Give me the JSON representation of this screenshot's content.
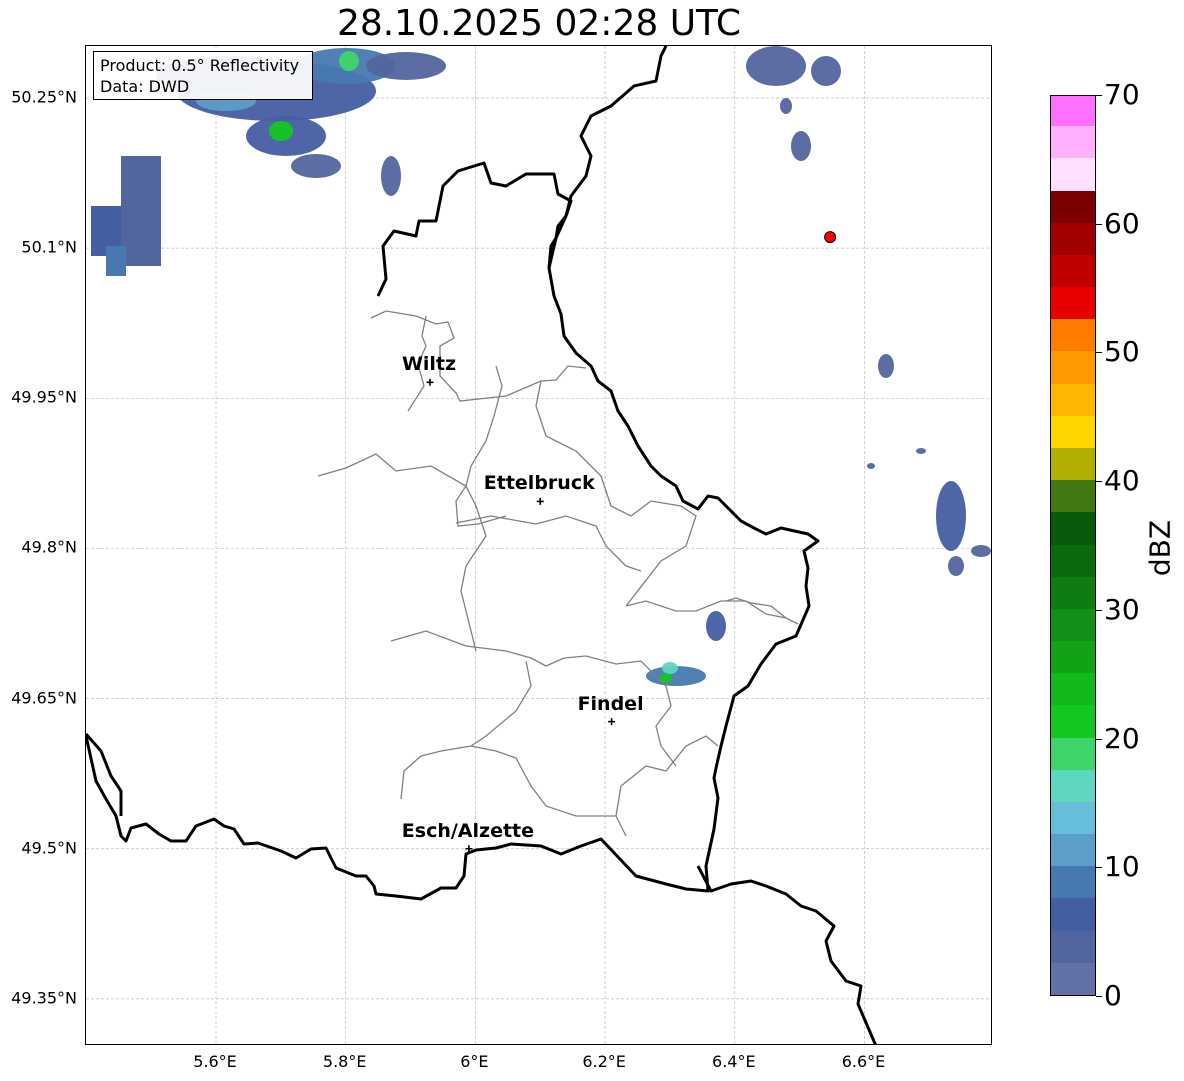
{
  "title": "28.10.2025 02:28 UTC",
  "info": {
    "product": "Product: 0.5° Reflectivity",
    "data": "Data: DWD"
  },
  "axes": {
    "lat_ticks": [
      "50.25°N",
      "50.1°N",
      "49.95°N",
      "49.8°N",
      "49.65°N",
      "49.5°N",
      "49.35°N"
    ],
    "lon_ticks": [
      "5.6°E",
      "5.8°E",
      "6°E",
      "6.2°E",
      "6.4°E",
      "6.6°E"
    ]
  },
  "cities": [
    {
      "name": "Wiltz",
      "lon": 5.93,
      "lat": 49.966
    },
    {
      "name": "Ettelbruck",
      "lon": 6.1,
      "lat": 49.847
    },
    {
      "name": "Findel",
      "lon": 6.21,
      "lat": 49.627
    },
    {
      "name": "Esch/Alzette",
      "lon": 5.99,
      "lat": 49.5
    }
  ],
  "radar_site": {
    "lon": 6.547,
    "lat": 50.111,
    "color": "#ff0000"
  },
  "colorbar": {
    "label": "dBZ",
    "ticks": [
      "0",
      "10",
      "20",
      "30",
      "40",
      "50",
      "60",
      "70"
    ],
    "min": 0,
    "max": 70,
    "step": 2.5,
    "colors": [
      "#6272a6",
      "#52659e",
      "#445ea3",
      "#4779b0",
      "#5b9ec7",
      "#66bedb",
      "#5ed6c0",
      "#3fd46b",
      "#12c81f",
      "#12b91a",
      "#12a216",
      "#118f16",
      "#0e7c13",
      "#0b6910",
      "#0a5a0d",
      "#427810",
      "#b0b000",
      "#ffd600",
      "#ffb600",
      "#ff9a00",
      "#ff7c00",
      "#e80000",
      "#c00000",
      "#a00000",
      "#7c0000",
      "#ffe0ff",
      "#ffb0ff",
      "#ff70ff",
      "#e93ae9"
    ]
  }
}
